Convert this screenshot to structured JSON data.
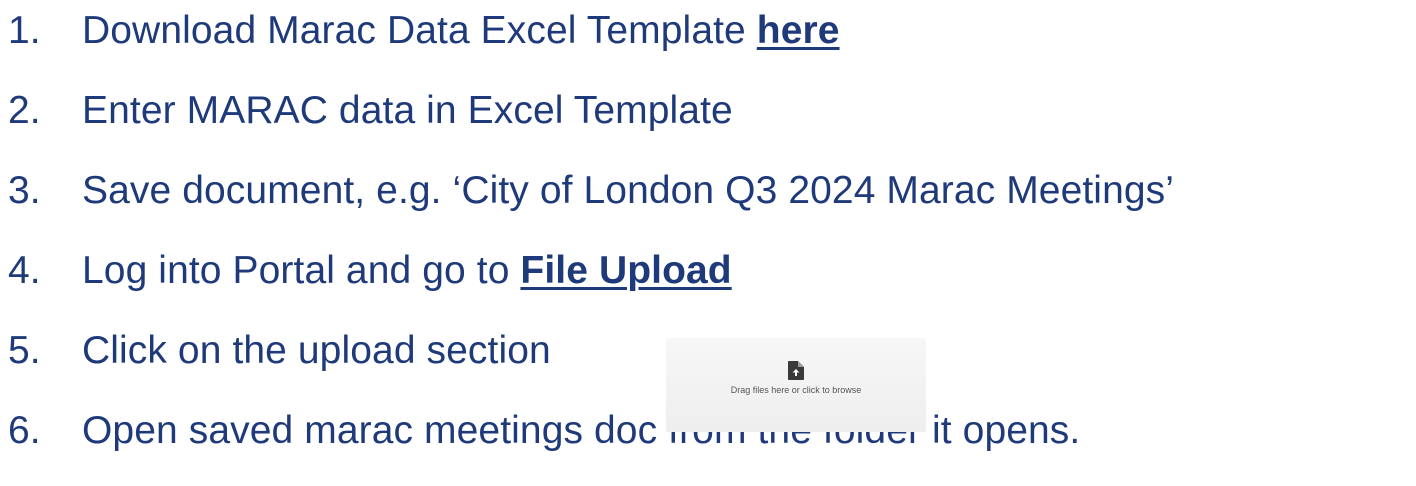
{
  "steps": [
    {
      "number": "1.",
      "text": "Download Marac Data Excel Template ",
      "link": "here"
    },
    {
      "number": "2.",
      "text": "Enter MARAC data in Excel Template"
    },
    {
      "number": "3.",
      "text": "Save document, e.g. ‘City of London Q3 2024 Marac Meetings’"
    },
    {
      "number": "4.",
      "text": "Log into Portal and go to ",
      "link": "File Upload"
    },
    {
      "number": "5.",
      "text": "Click on the upload section"
    },
    {
      "number": "6.",
      "text": "Open saved marac meetings doc from the folder it opens."
    }
  ],
  "upload_widget": {
    "icon": "file-upload-icon",
    "text": "Drag files here or click to browse"
  },
  "colors": {
    "text": "#1f3a7a",
    "widget_background": "#f2f2f2"
  }
}
